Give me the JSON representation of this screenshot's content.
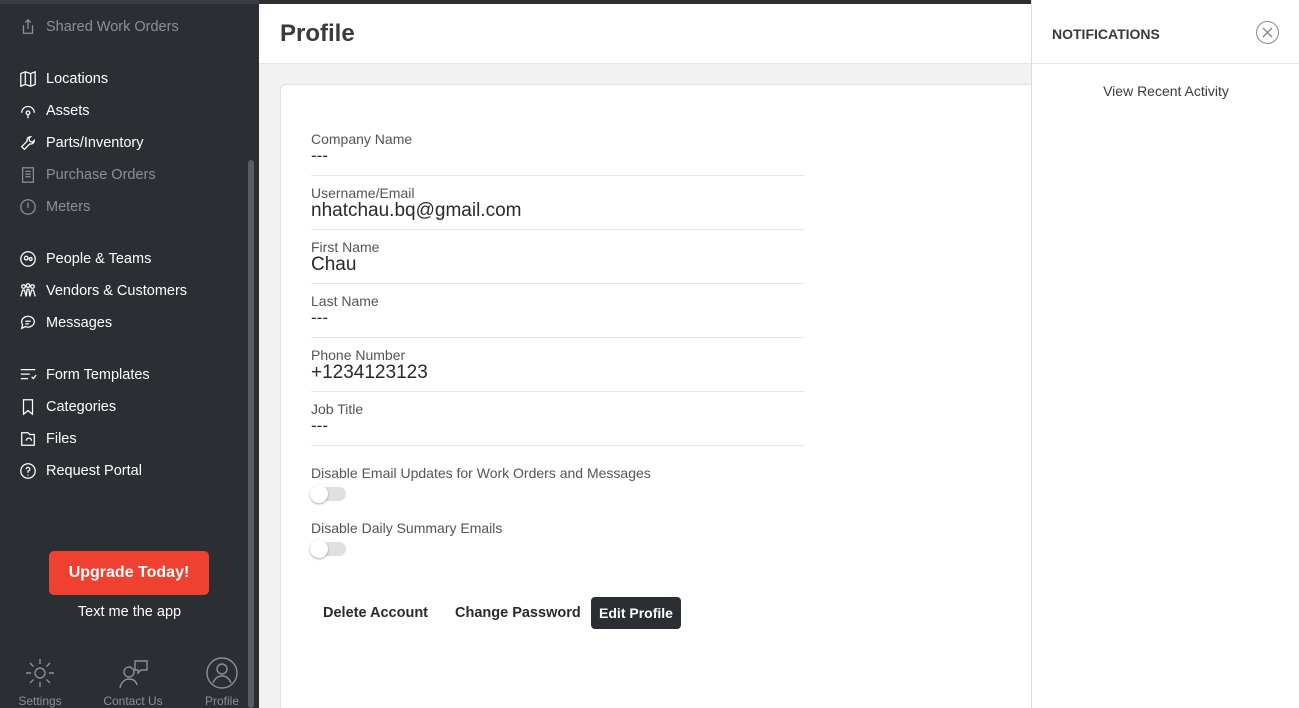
{
  "sidebar": {
    "items": [
      {
        "label": "Shared Work Orders",
        "icon": "share-icon",
        "dim": true
      },
      {
        "label": "Locations",
        "icon": "map-icon",
        "dim": false
      },
      {
        "label": "Assets",
        "icon": "asset-icon",
        "dim": false
      },
      {
        "label": "Parts/Inventory",
        "icon": "wrench-icon",
        "dim": false
      },
      {
        "label": "Purchase Orders",
        "icon": "document-icon",
        "dim": true
      },
      {
        "label": "Meters",
        "icon": "meter-icon",
        "dim": true
      },
      {
        "label": "People & Teams",
        "icon": "people-icon",
        "dim": false
      },
      {
        "label": "Vendors & Customers",
        "icon": "vendors-icon",
        "dim": false
      },
      {
        "label": "Messages",
        "icon": "chat-icon",
        "dim": false
      },
      {
        "label": "Form Templates",
        "icon": "form-icon",
        "dim": false
      },
      {
        "label": "Categories",
        "icon": "bookmark-icon",
        "dim": false
      },
      {
        "label": "Files",
        "icon": "file-icon",
        "dim": false
      },
      {
        "label": "Request Portal",
        "icon": "question-icon",
        "dim": false
      }
    ],
    "upgrade_label": "Upgrade Today!",
    "text_app_label": "Text me the app",
    "bottom": [
      {
        "label": "Settings",
        "icon": "gear-icon"
      },
      {
        "label": "Contact Us",
        "icon": "contact-icon"
      },
      {
        "label": "Profile",
        "icon": "profile-icon"
      }
    ],
    "colors": {
      "background": "#2b2e33",
      "upgrade": "#f0402f"
    }
  },
  "header": {
    "title": "Profile"
  },
  "profile": {
    "fields": [
      {
        "label": "Company Name",
        "value": "---"
      },
      {
        "label": "Username/Email",
        "value": "nhatchau.bq@gmail.com"
      },
      {
        "label": "First Name",
        "value": "Chau"
      },
      {
        "label": "Last Name",
        "value": "---"
      },
      {
        "label": "Phone Number",
        "value": "+1234123123"
      },
      {
        "label": "Job Title",
        "value": "---"
      }
    ],
    "toggles": [
      {
        "label": "Disable Email Updates for Work Orders and Messages",
        "on": false
      },
      {
        "label": "Disable Daily Summary Emails",
        "on": false
      }
    ],
    "actions": {
      "delete_label": "Delete Account",
      "change_password_label": "Change Password",
      "edit_label": "Edit Profile"
    }
  },
  "notifications": {
    "title": "NOTIFICATIONS",
    "recent_label": "View Recent Activity",
    "close_icon": "close-icon"
  }
}
